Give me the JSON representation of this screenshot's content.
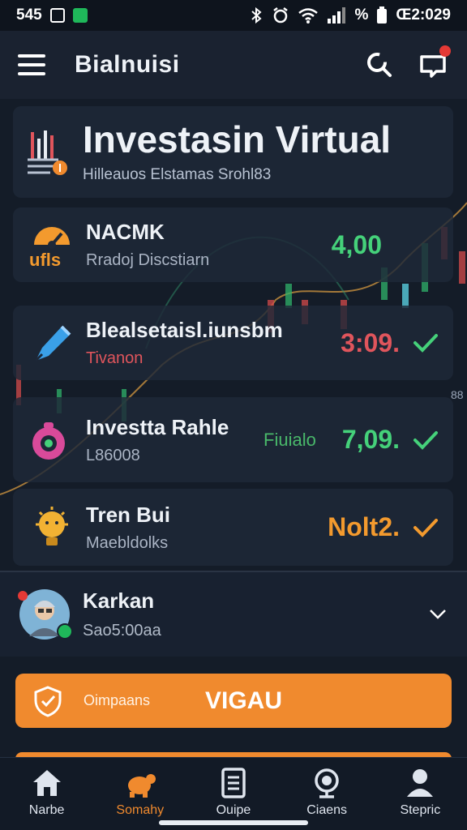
{
  "status_bar": {
    "time_left": "545",
    "battery_text": "%",
    "time_right": "Œ2:029"
  },
  "app_bar": {
    "title": "Bialnuisi"
  },
  "hero": {
    "title": "Investasin Virtual",
    "subtitle": "Hilleauos Elstamas Srohl83"
  },
  "rows": [
    {
      "name": "NACMK",
      "sub": "Rradoj Discstiarn",
      "icon_text": "ufls",
      "value": "4,00",
      "value_color": "#45d17a",
      "check": false
    },
    {
      "name": "Blealsetaisl.iunsbm",
      "sub": "Tivanon",
      "value": "3:09.",
      "value_color": "#e0555c",
      "check": true
    },
    {
      "name": "Investta Rahle",
      "sub": "L86008",
      "mid": "Fiuialo",
      "value": "7,09.",
      "value_color": "#45d17a",
      "check": true
    },
    {
      "name": "Tren Bui",
      "sub": "Maebldolks",
      "value": "Nolt2.",
      "value_color": "#f39a2e",
      "check": true
    }
  ],
  "chart_side_label": "88",
  "user": {
    "name": "Karkan",
    "sub": "Sao5:00aa"
  },
  "cta": {
    "small_label": "Oimpaans",
    "big_label": "VIGAU"
  },
  "nav": [
    {
      "label": "Narbe",
      "icon": "home-icon"
    },
    {
      "label": "Somahy",
      "icon": "turtle-icon"
    },
    {
      "label": "Ouipe",
      "icon": "document-icon"
    },
    {
      "label": "Ciaens",
      "icon": "magnifier-icon"
    },
    {
      "label": "Stepric",
      "icon": "user-icon"
    }
  ],
  "colors": {
    "accent": "#f08a2e",
    "background": "#141c28",
    "up": "#45d17a",
    "down": "#e0555c"
  }
}
